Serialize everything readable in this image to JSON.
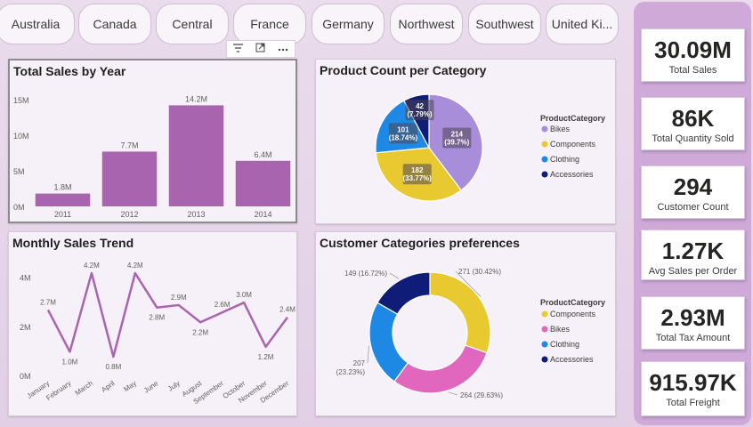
{
  "slicer": {
    "items": [
      "Australia",
      "Canada",
      "Central",
      "France",
      "Germany",
      "Northwest",
      "Southwest",
      "United Ki..."
    ]
  },
  "visual_header": {
    "icons": [
      "filter-icon",
      "focus-mode-icon",
      "more-options-icon"
    ]
  },
  "sales_by_year": {
    "title": "Total Sales by Year",
    "chart_data": {
      "type": "bar",
      "categories": [
        "2011",
        "2012",
        "2013",
        "2014"
      ],
      "values": [
        1.8,
        7.7,
        14.2,
        6.4
      ],
      "data_labels": [
        "1.8M",
        "7.7M",
        "14.2M",
        "6.4M"
      ],
      "y_ticks": [
        "0M",
        "5M",
        "10M",
        "15M"
      ],
      "ylim": [
        0,
        15.5
      ],
      "unit": "M",
      "color": "#a964b0",
      "grid": false
    }
  },
  "product_count": {
    "title": "Product Count per Category",
    "chart_data": {
      "type": "pie",
      "legend_title": "ProductCategory",
      "legend_position": "right",
      "slices": [
        {
          "name": "Bikes",
          "value": 214,
          "pct": "(39.7%)",
          "color": "#a88ddb"
        },
        {
          "name": "Components",
          "value": 182,
          "pct": "(33.77%)",
          "color": "#e9c930"
        },
        {
          "name": "Clothing",
          "value": 101,
          "pct": "(18.74%)",
          "color": "#1e88e5"
        },
        {
          "name": "Accessories",
          "value": 42,
          "pct": "(7.79%)",
          "color": "#0f1c78"
        }
      ]
    }
  },
  "monthly_trend": {
    "title": "Monthly Sales Trend",
    "chart_data": {
      "type": "line",
      "categories": [
        "January",
        "February",
        "March",
        "April",
        "May",
        "June",
        "July",
        "August",
        "September",
        "October",
        "November",
        "December"
      ],
      "values": [
        2.7,
        1.0,
        4.2,
        0.8,
        4.2,
        2.8,
        2.9,
        2.2,
        2.6,
        3.0,
        1.2,
        2.4
      ],
      "data_labels": [
        "2.7M",
        "1.0M",
        "4.2M",
        "0.8M",
        "4.2M",
        "2.8M",
        "2.9M",
        "2.2M",
        "2.6M",
        "3.0M",
        "1.2M",
        "2.4M"
      ],
      "y_ticks": [
        "0M",
        "2M",
        "4M"
      ],
      "ylim": [
        0,
        4.6
      ],
      "color": "#a964b0",
      "grid": false
    }
  },
  "customer_prefs": {
    "title": "Customer Categories preferences",
    "chart_data": {
      "type": "pie",
      "donut": true,
      "legend_title": "ProductCategory",
      "legend_position": "right",
      "slices": [
        {
          "name": "Components",
          "value": 271,
          "label": "271 (30.42%)",
          "color": "#e9c930"
        },
        {
          "name": "Bikes",
          "value": 264,
          "label": "264 (29.63%)",
          "color": "#e066be"
        },
        {
          "name": "Clothing",
          "value": 207,
          "label": "207",
          "label2": "(23.23%)",
          "color": "#1e88e5"
        },
        {
          "name": "Accessories",
          "value": 149,
          "label": "149 (16.72%)",
          "color": "#0f1c78"
        }
      ]
    }
  },
  "kpis": [
    {
      "value": "30.09M",
      "label": "Total Sales"
    },
    {
      "value": "86K",
      "label": "Total Quantity Sold"
    },
    {
      "value": "294",
      "label": "Customer Count"
    },
    {
      "value": "1.27K",
      "label": "Avg Sales per Order"
    },
    {
      "value": "2.93M",
      "label": "Total Tax Amount"
    },
    {
      "value": "915.97K",
      "label": "Total Freight"
    }
  ],
  "colors": {
    "panel": "#cfa9d8",
    "accent": "#a964b0"
  }
}
